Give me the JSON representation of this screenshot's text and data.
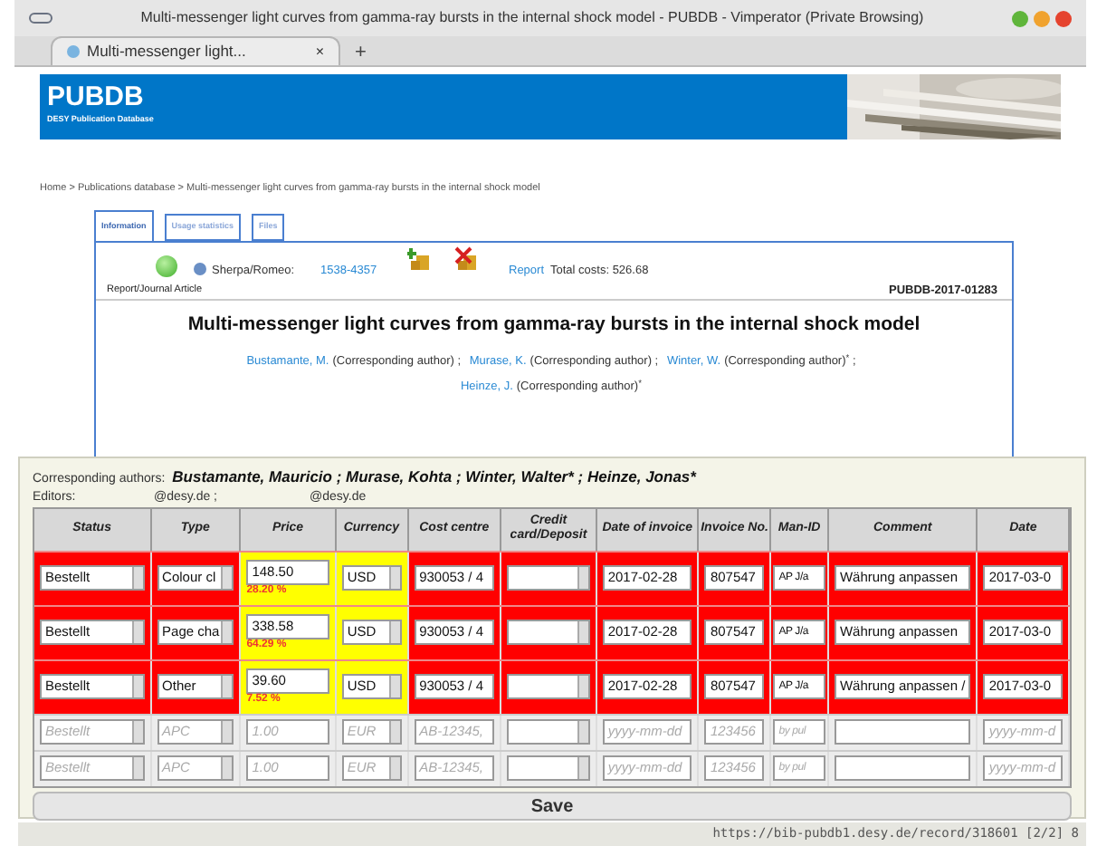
{
  "window": {
    "title": "Multi-messenger light curves from gamma-ray bursts in the internal shock model - PUBDB - Vimperator (Private Browsing)"
  },
  "browser_tabs": [
    {
      "label": "Multi-messenger light...",
      "close": "×",
      "selected": true
    }
  ],
  "new_tab": "+",
  "banner": {
    "title": "PUBDB",
    "subtitle": "DESY Publication Database"
  },
  "breadcrumb": "Home > Publications database > Multi-messenger light curves from gamma-ray bursts in the internal shock model",
  "page_tabs": [
    {
      "label": "Information",
      "selected": true
    },
    {
      "label": "Usage statistics",
      "selected": false
    },
    {
      "label": "Files",
      "selected": false
    }
  ],
  "record": {
    "sherpa_label": "Sherpa/Romeo:",
    "sherpa_link": "1538-4357",
    "report_link": "Report",
    "total_costs": "Total costs: 526.68",
    "type": "Report/Journal Article",
    "id": "PUBDB-2017-01283",
    "title": "Multi-messenger light curves from gamma-ray bursts in the internal shock model",
    "authors": [
      {
        "name": "Bustamante, M.",
        "role": "(Corresponding author)$^{}$ ;"
      },
      {
        "name": "Murase, K.",
        "role": "(Corresponding author) ;"
      },
      {
        "name": "Winter, W.",
        "role": "(Corresponding author)$^{*}$ ;"
      },
      {
        "name": "Heinze, J.",
        "role": "(Corresponding author)$^{*}$"
      }
    ]
  },
  "costs": {
    "corresponding_label": "Corresponding authors:",
    "corresponding": "Bustamante, Mauricio ; Murase, Kohta ; Winter, Walter* ; Heinze, Jonas*",
    "editors_label": "Editors:",
    "editors": [
      "@desy.de ;",
      "@desy.de"
    ],
    "columns": [
      "Status",
      "Type",
      "Price",
      "Currency",
      "Cost centre",
      "Credit card/Deposit",
      "Date of invoice",
      "Invoice No.",
      "Man-ID",
      "Comment",
      "Date"
    ],
    "rows": [
      {
        "kind": "entry",
        "status": "Bestellt",
        "type": "Colour cl",
        "price": "148.50",
        "share": "28.20 %",
        "currency": "USD",
        "cost_centre": "930053 / 4",
        "date_of_invoice": "2017-02-28",
        "invoice_no": "807547",
        "man_id": "AP J/a",
        "comment": "Währung anpassen",
        "date": "2017-03-0"
      },
      {
        "kind": "entry",
        "status": "Bestellt",
        "type": "Page cha",
        "price": "338.58",
        "share": "64.29 %",
        "currency": "USD",
        "cost_centre": "930053 / 4",
        "date_of_invoice": "2017-02-28",
        "invoice_no": "807547",
        "man_id": "AP J/a",
        "comment": "Währung anpassen",
        "date": "2017-03-0"
      },
      {
        "kind": "entry",
        "status": "Bestellt",
        "type": "Other",
        "price": "39.60",
        "share": "7.52 %",
        "currency": "USD",
        "cost_centre": "930053 / 4",
        "date_of_invoice": "2017-02-28",
        "invoice_no": "807547",
        "man_id": "AP J/a",
        "comment": "Währung anpassen /",
        "date": "2017-03-0"
      },
      {
        "kind": "new",
        "status": "Bestellt",
        "type": "APC",
        "price": "1.00",
        "currency": "EUR",
        "cost_centre": "AB-12345,",
        "date_of_invoice": "yyyy-mm-dd",
        "invoice_no": "123456",
        "man_id": "by pul",
        "date": "yyyy-mm-d"
      },
      {
        "kind": "new",
        "status": "Bestellt",
        "type": "APC",
        "price": "1.00",
        "currency": "EUR",
        "cost_centre": "AB-12345,",
        "date_of_invoice": "yyyy-mm-dd",
        "invoice_no": "123456",
        "man_id": "by pul",
        "date": "yyyy-mm-d"
      }
    ],
    "save": "Save"
  },
  "status_bar": "https://bib-pubdb1.desy.de/record/318601 [2/2] 8"
}
